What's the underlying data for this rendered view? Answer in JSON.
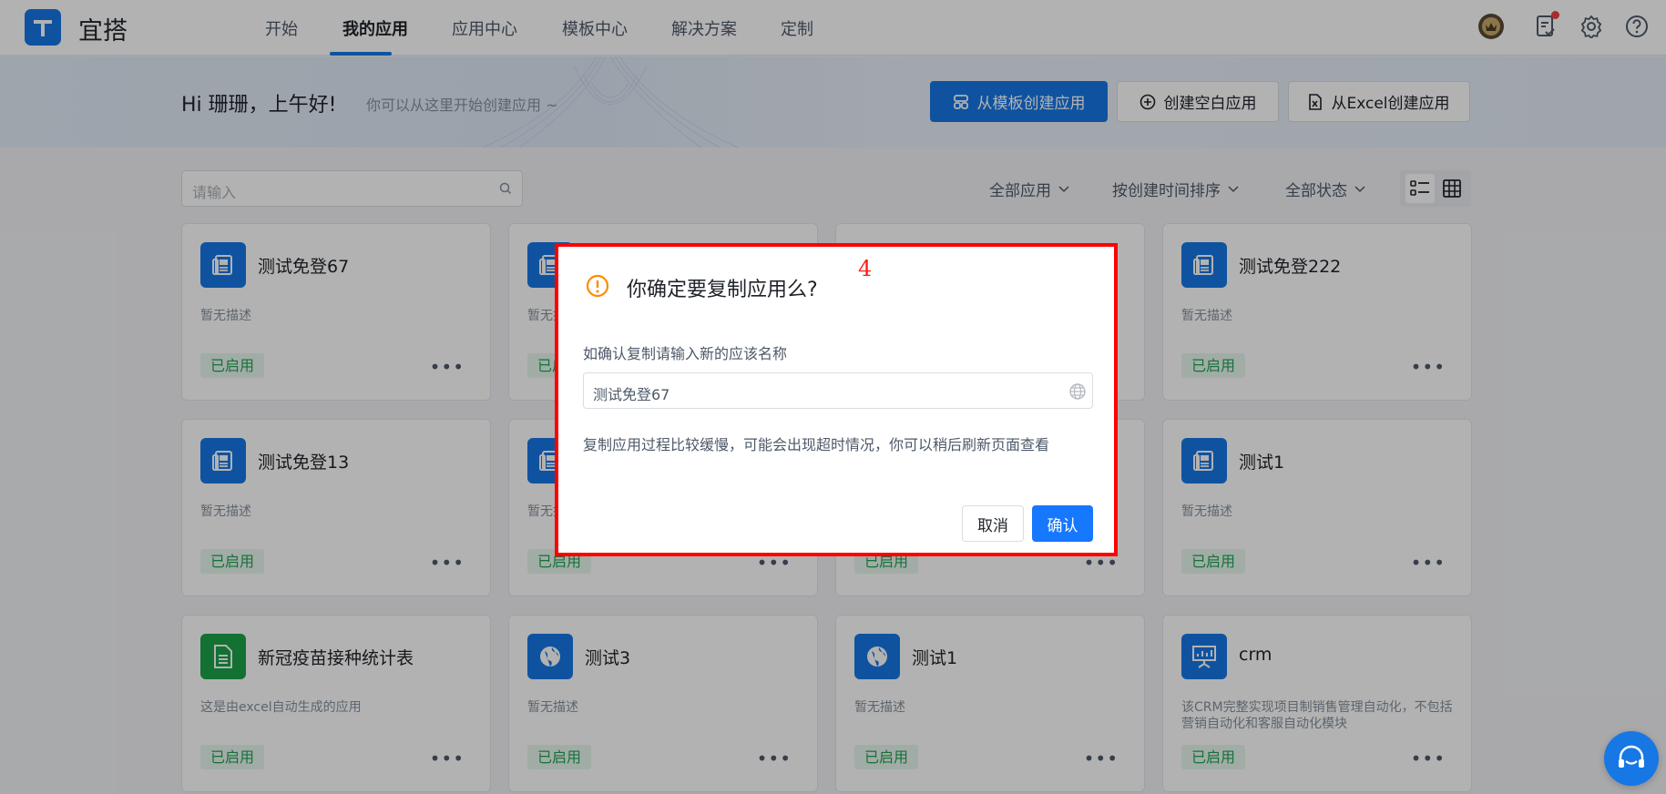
{
  "app": {
    "logo_text": "宜搭"
  },
  "nav": {
    "items": [
      {
        "label": "开始"
      },
      {
        "label": "我的应用",
        "active": true
      },
      {
        "label": "应用中心"
      },
      {
        "label": "模板中心"
      },
      {
        "label": "解决方案"
      },
      {
        "label": "定制"
      }
    ]
  },
  "topbar_icons": [
    "avatar-icon",
    "task-icon",
    "gear-icon",
    "help-icon"
  ],
  "banner": {
    "greeting": "Hi 珊珊，上午好!",
    "subtitle": "你可以从这里开始创建应用 ~",
    "btn_template": "从模板创建应用",
    "btn_blank": "创建空白应用",
    "btn_excel": "从Excel创建应用"
  },
  "toolbar": {
    "search_placeholder": "请输入",
    "filter_apps": "全部应用",
    "filter_sort": "按创建时间排序",
    "filter_status": "全部状态"
  },
  "cards": [
    {
      "title": "测试免登67",
      "desc": "暂无描述",
      "status": "已启用",
      "icon": "doc-icon",
      "color": "#1677e5"
    },
    {
      "title": "",
      "desc": "暂无描述",
      "status": "已启用",
      "icon": "doc-icon",
      "color": "#1677e5"
    },
    {
      "title": "",
      "desc": "",
      "status": "",
      "icon": "",
      "color": "#1677e5"
    },
    {
      "title": "测试免登222",
      "desc": "暂无描述",
      "status": "已启用",
      "icon": "doc-icon",
      "color": "#1677e5"
    },
    {
      "title": "测试免登13",
      "desc": "暂无描述",
      "status": "已启用",
      "icon": "doc-icon",
      "color": "#1677e5"
    },
    {
      "title": "",
      "desc": "暂无描述",
      "status": "已启用",
      "icon": "doc-icon",
      "color": "#1677e5"
    },
    {
      "title": "",
      "desc": "",
      "status": "已启用",
      "icon": "",
      "color": "#1677e5"
    },
    {
      "title": "测试1",
      "desc": "暂无描述",
      "status": "已启用",
      "icon": "doc-icon",
      "color": "#1677e5"
    },
    {
      "title": "新冠疫苗接种统计表",
      "desc": "这是由excel自动生成的应用",
      "status": "已启用",
      "icon": "sheet-icon",
      "color": "#1aa34a"
    },
    {
      "title": "测试3",
      "desc": "暂无描述",
      "status": "已启用",
      "icon": "globe-icon",
      "color": "#1677e5"
    },
    {
      "title": "测试1",
      "desc": "暂无描述",
      "status": "已启用",
      "icon": "globe-icon",
      "color": "#1677e5"
    },
    {
      "title": "crm",
      "desc": "该CRM完整实现项目制销售管理自动化，不包括营销自动化和客服自动化模块",
      "status": "已启用",
      "icon": "presentation-icon",
      "color": "#1677e5"
    }
  ],
  "modal": {
    "title": "你确定要复制应用么?",
    "annotation": "4",
    "label": "如确认复制请输入新的应该名称",
    "input_value": "测试免登67",
    "hint": "复制应用过程比较缓慢，可能会出现超时情况，你可以稍后刷新页面查看",
    "cancel": "取消",
    "confirm": "确认"
  }
}
